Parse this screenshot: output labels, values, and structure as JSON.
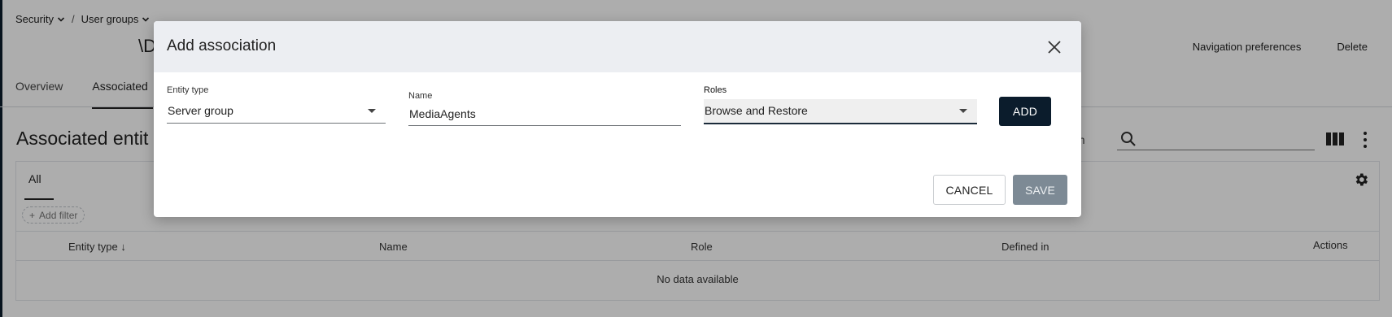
{
  "breadcrumb": {
    "items": [
      "Security",
      "User groups"
    ],
    "separator": "/"
  },
  "page": {
    "title_tail": "\\D",
    "actions": [
      "Navigation preferences",
      "Delete"
    ],
    "tabs": [
      "Overview",
      "Associated"
    ],
    "active_tab": "Associated"
  },
  "section": {
    "title": "Associated entit",
    "toolbar_tail": "on",
    "search": {
      "value": "",
      "placeholder": ""
    },
    "view_tab": "All",
    "add_filter_label": "Add filter"
  },
  "table": {
    "columns": [
      "Entity type",
      "Name",
      "Role",
      "Defined in",
      "Actions"
    ],
    "sort_indicator": "↓",
    "empty_text": "No data available"
  },
  "modal": {
    "title": "Add association",
    "fields": {
      "entity_type": {
        "label": "Entity type",
        "value": "Server group"
      },
      "name": {
        "label": "Name",
        "value": "MediaAgents"
      },
      "roles": {
        "label": "Roles",
        "value": "Browse and Restore"
      }
    },
    "add_label": "ADD",
    "cancel_label": "CANCEL",
    "save_label": "SAVE"
  },
  "icons": {
    "breadcrumb_caret": "chevron-down-icon",
    "close": "close-icon",
    "search": "search-icon",
    "columns": "columns-icon",
    "more": "more-vertical-icon",
    "settings": "gear-icon",
    "add_filter": "plus-icon",
    "dropdown": "caret-down-icon"
  },
  "colors": {
    "primary_button": "#0b1c2c",
    "save_disabled": "#7d8a95",
    "modal_header_bg": "#eceef2",
    "overlay": "rgba(0,0,0,0.32)"
  }
}
